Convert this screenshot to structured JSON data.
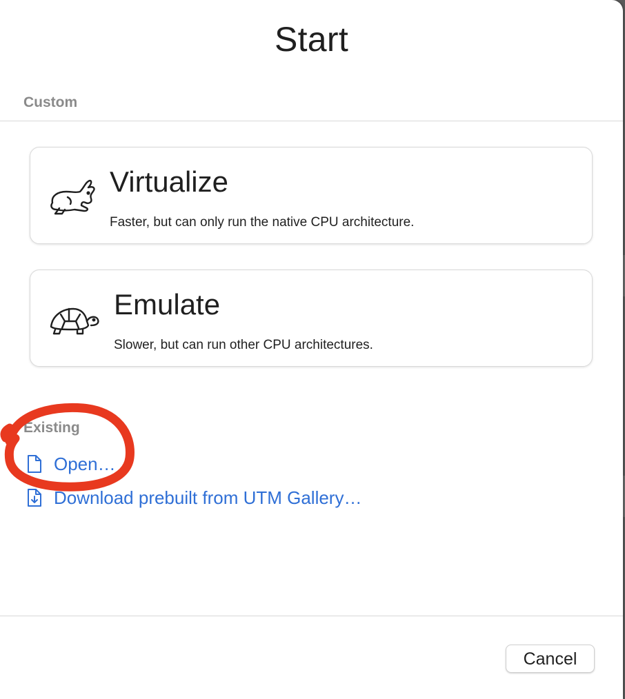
{
  "dialog": {
    "title": "Start"
  },
  "custom": {
    "header": "Custom",
    "options": [
      {
        "title": "Virtualize",
        "description": "Faster, but can only run the native CPU architecture.",
        "icon": "hare-icon"
      },
      {
        "title": "Emulate",
        "description": "Slower, but can run other CPU architectures.",
        "icon": "tortoise-icon"
      }
    ]
  },
  "existing": {
    "header": "Existing",
    "links": [
      {
        "label": "Open…",
        "icon": "document-icon"
      },
      {
        "label": "Download prebuilt from UTM Gallery…",
        "icon": "document-download-icon"
      }
    ]
  },
  "footer": {
    "cancel_label": "Cancel"
  },
  "colors": {
    "link": "#2f6fd6",
    "section_header": "#8a8a8a",
    "annotation": "#e8391f"
  }
}
